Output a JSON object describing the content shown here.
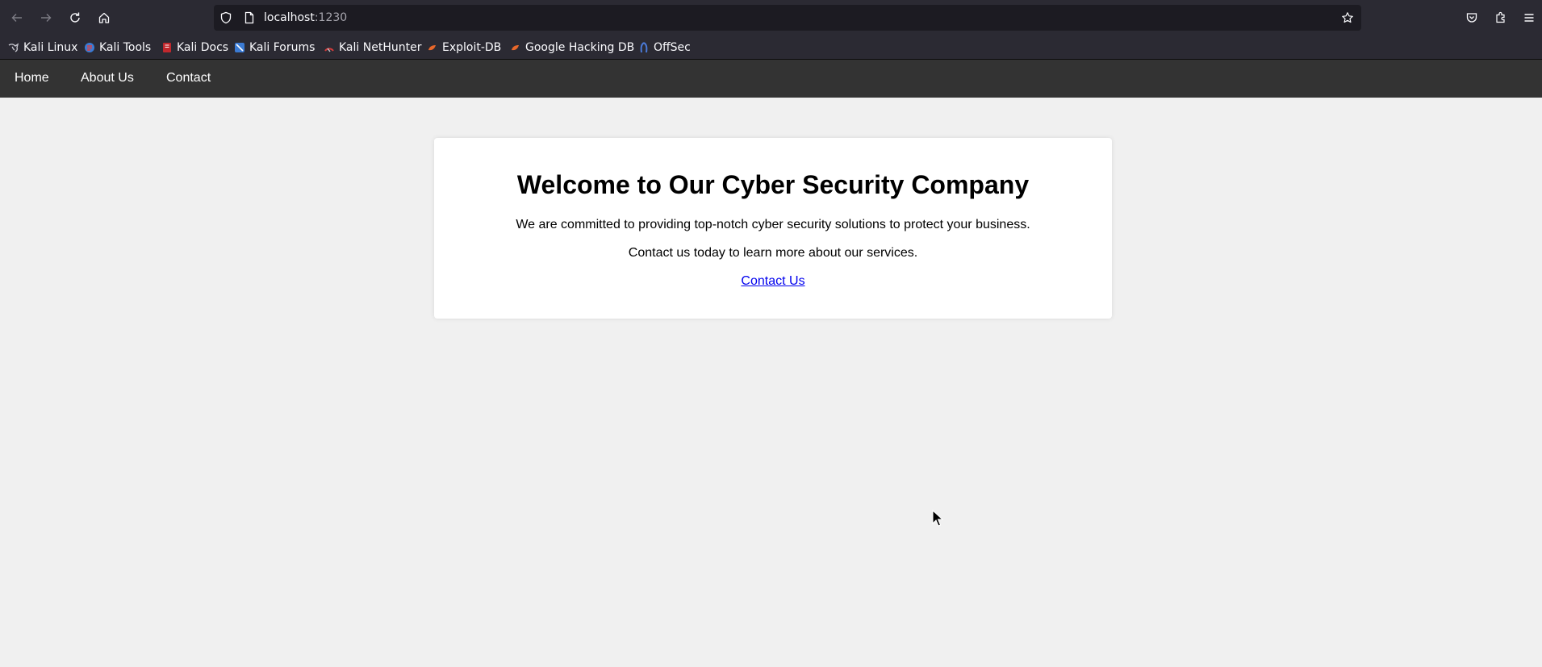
{
  "browser": {
    "url_host": "localhost",
    "url_port": ":1230",
    "bookmarks": [
      {
        "label": "Kali Linux",
        "icon": "kali-dragon-icon"
      },
      {
        "label": "Kali Tools",
        "icon": "kali-tools-icon"
      },
      {
        "label": "Kali Docs",
        "icon": "kali-docs-icon"
      },
      {
        "label": "Kali Forums",
        "icon": "kali-forums-icon"
      },
      {
        "label": "Kali NetHunter",
        "icon": "nethunter-icon"
      },
      {
        "label": "Exploit-DB",
        "icon": "exploit-db-icon"
      },
      {
        "label": "Google Hacking DB",
        "icon": "ghdb-icon"
      },
      {
        "label": "OffSec",
        "icon": "offsec-icon"
      }
    ]
  },
  "nav": {
    "home": "Home",
    "about": "About Us",
    "contact": "Contact"
  },
  "main": {
    "title": "Welcome to Our Cyber Security Company",
    "paragraph1": "We are committed to providing top-notch cyber security solutions to protect your business.",
    "paragraph2": "Contact us today to learn more about our services.",
    "cta": "Contact Us"
  },
  "colors": {
    "navbar_bg": "#333333",
    "page_bg": "#f0f0f0",
    "link": "#0000ee",
    "chrome_bg": "#2b2a33"
  }
}
